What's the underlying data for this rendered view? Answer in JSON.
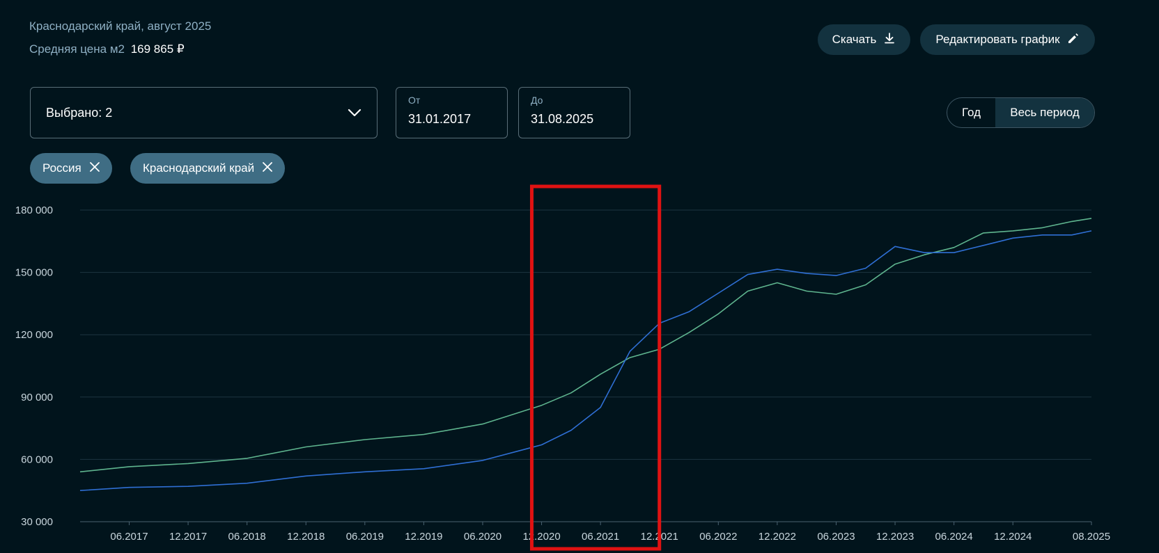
{
  "header": {
    "region_period": "Краснодарский край, август 2025",
    "avg_price_label": "Средняя цена м2",
    "avg_price_value": "169 865 ₽"
  },
  "toolbar": {
    "download_label": "Скачать",
    "edit_label": "Редактировать график"
  },
  "filters": {
    "selected_label": "Выбрано: 2",
    "from_label": "От",
    "from_value": "31.01.2017",
    "to_label": "До",
    "to_value": "31.08.2025",
    "tags": [
      "Россия",
      "Краснодарский край"
    ]
  },
  "period": {
    "year_label": "Год",
    "all_label": "Весь период",
    "active": "Весь период"
  },
  "chart_data": {
    "type": "line",
    "ylim": [
      30000,
      180000
    ],
    "yticks": [
      30000,
      60000,
      90000,
      120000,
      150000,
      180000
    ],
    "ytick_labels": [
      "30 000",
      "60 000",
      "90 000",
      "120 000",
      "150 000",
      "180 000"
    ],
    "xlim": [
      "2017-01",
      "2025-08"
    ],
    "xticks": [
      "2017-06",
      "2017-12",
      "2018-06",
      "2018-12",
      "2019-06",
      "2019-12",
      "2020-06",
      "2020-12",
      "2021-06",
      "2021-12",
      "2022-06",
      "2022-12",
      "2023-06",
      "2023-12",
      "2024-06",
      "2024-12",
      "2025-08"
    ],
    "xtick_labels": [
      "06.2017",
      "12.2017",
      "06.2018",
      "12.2018",
      "06.2019",
      "12.2019",
      "06.2020",
      "12.2020",
      "06.2021",
      "12.2021",
      "06.2022",
      "12.2022",
      "06.2023",
      "12.2023",
      "06.2024",
      "12.2024",
      "08.2025"
    ],
    "grid": true,
    "series": [
      {
        "color": "#5fb58f",
        "points": [
          [
            "2017-01",
            54000
          ],
          [
            "2017-06",
            56500
          ],
          [
            "2017-12",
            58000
          ],
          [
            "2018-06",
            60500
          ],
          [
            "2018-12",
            66000
          ],
          [
            "2019-06",
            69500
          ],
          [
            "2019-12",
            72000
          ],
          [
            "2020-06",
            77000
          ],
          [
            "2020-12",
            86000
          ],
          [
            "2021-03",
            92000
          ],
          [
            "2021-06",
            101000
          ],
          [
            "2021-09",
            109000
          ],
          [
            "2021-12",
            113000
          ],
          [
            "2022-03",
            121000
          ],
          [
            "2022-06",
            130000
          ],
          [
            "2022-09",
            141000
          ],
          [
            "2022-12",
            145000
          ],
          [
            "2023-03",
            141000
          ],
          [
            "2023-06",
            139500
          ],
          [
            "2023-09",
            144000
          ],
          [
            "2023-12",
            154000
          ],
          [
            "2024-03",
            158500
          ],
          [
            "2024-06",
            162000
          ],
          [
            "2024-09",
            169000
          ],
          [
            "2024-12",
            170000
          ],
          [
            "2025-03",
            171500
          ],
          [
            "2025-06",
            174500
          ],
          [
            "2025-08",
            176000
          ]
        ]
      },
      {
        "color": "#2f6fd4",
        "points": [
          [
            "2017-01",
            45000
          ],
          [
            "2017-06",
            46500
          ],
          [
            "2017-12",
            47000
          ],
          [
            "2018-06",
            48500
          ],
          [
            "2018-12",
            52000
          ],
          [
            "2019-06",
            54000
          ],
          [
            "2019-12",
            55500
          ],
          [
            "2020-06",
            59500
          ],
          [
            "2020-12",
            67000
          ],
          [
            "2021-03",
            74000
          ],
          [
            "2021-06",
            85000
          ],
          [
            "2021-09",
            112000
          ],
          [
            "2021-12",
            125500
          ],
          [
            "2022-03",
            131000
          ],
          [
            "2022-06",
            140000
          ],
          [
            "2022-09",
            149000
          ],
          [
            "2022-12",
            151500
          ],
          [
            "2023-03",
            149500
          ],
          [
            "2023-06",
            148500
          ],
          [
            "2023-09",
            152000
          ],
          [
            "2023-12",
            162500
          ],
          [
            "2024-03",
            159500
          ],
          [
            "2024-06",
            159500
          ],
          [
            "2024-09",
            163000
          ],
          [
            "2024-12",
            166500
          ],
          [
            "2025-03",
            168000
          ],
          [
            "2025-06",
            168000
          ],
          [
            "2025-08",
            170000
          ]
        ]
      }
    ],
    "highlight_rect": {
      "x_from": "2020-11",
      "x_to": "2021-12"
    }
  }
}
